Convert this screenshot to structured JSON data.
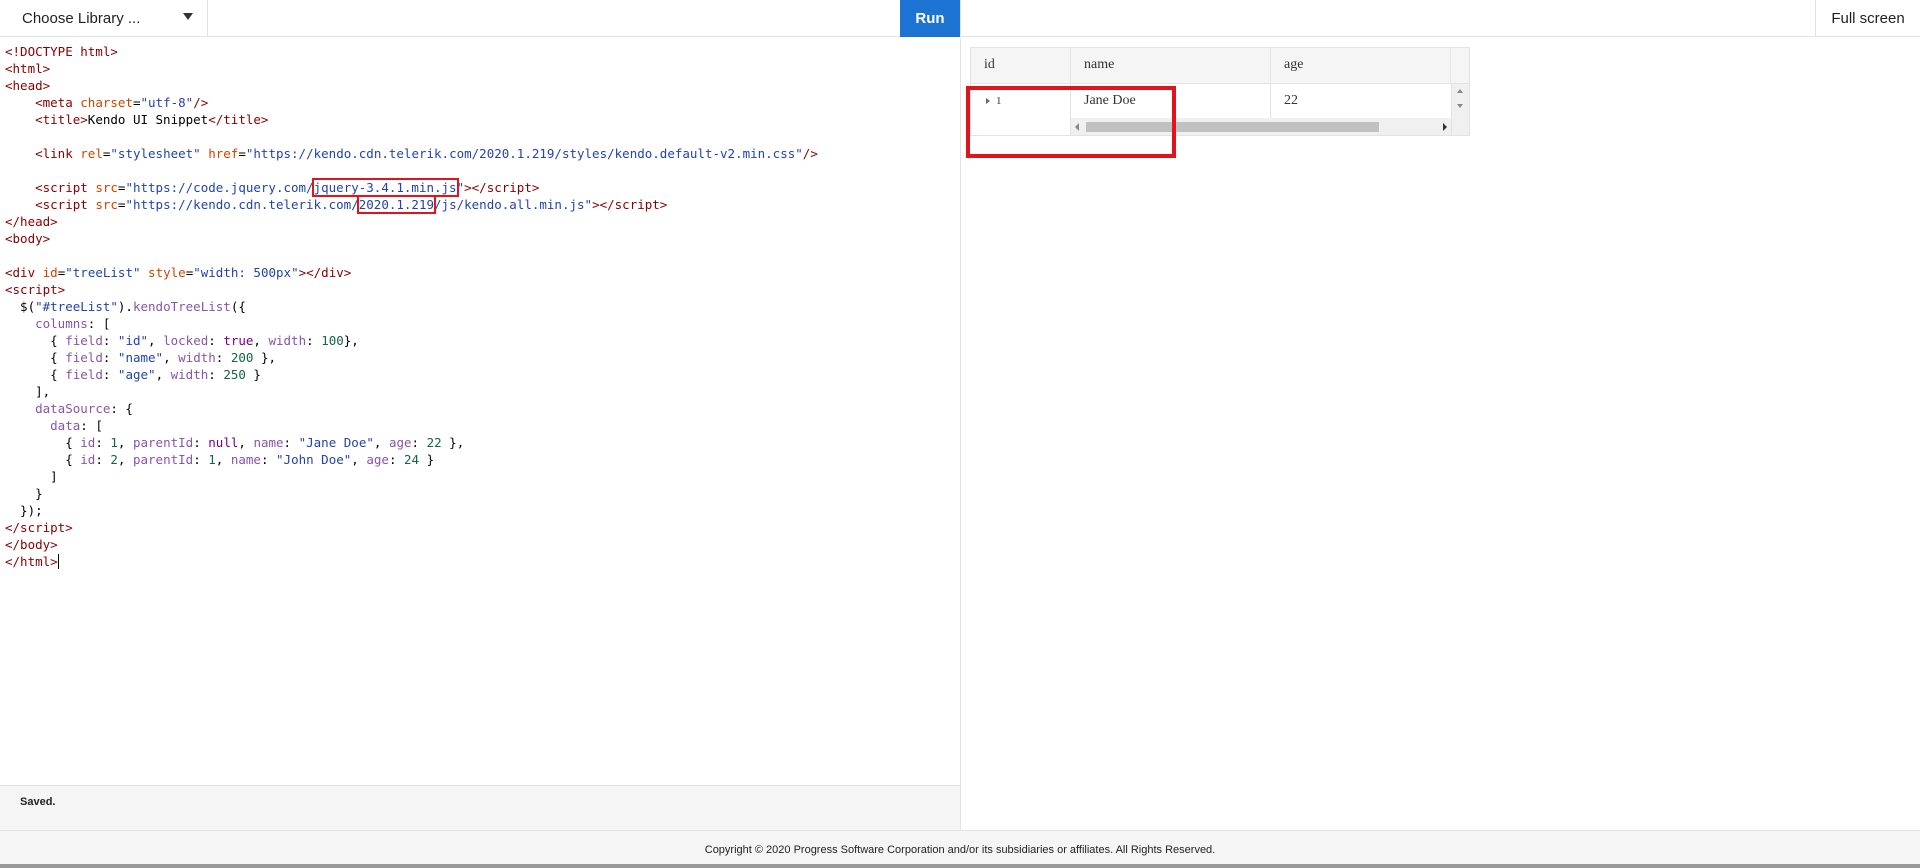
{
  "toolbar": {
    "library_label": "Choose Library ...",
    "run_label": "Run",
    "fullscreen_label": "Full screen"
  },
  "editor": {
    "lines": {
      "l1": "<!DOCTYPE html>",
      "l2": "<html>",
      "l3": "<head>",
      "meta_charset": "utf-8",
      "title_text": "Kendo UI Snippet",
      "link_href": "https://kendo.cdn.telerik.com/2020.1.219/styles/kendo.default-v2.min.css",
      "script1_prefix": "https://code.jquery.com/",
      "script1_file": "jquery-3.4.1.min.js",
      "script2_prefix": "https://kendo.cdn.telerik.com/",
      "script2_version": "2020.1.219",
      "script2_suffix": "/js/kendo.all.min.js",
      "div_id": "treeList",
      "div_style": "width: 500px",
      "selector": "\"#treeList\"",
      "method": "kendoTreeList",
      "field_id": "\"id\"",
      "field_name": "\"name\"",
      "field_age": "\"age\"",
      "name1": "\"Jane Doe\"",
      "name2": "\"John Doe\""
    }
  },
  "status": {
    "text": "Saved."
  },
  "preview": {
    "columns": [
      "id",
      "name",
      "age"
    ],
    "row": {
      "id": "1",
      "name": "Jane Doe",
      "age": "22"
    }
  },
  "footer": {
    "copyright": "Copyright © 2020 Progress Software Corporation and/or its subsidiaries or affiliates. All Rights Reserved."
  },
  "colors": {
    "run_button": "#1d73d1",
    "highlight": "#e0141b"
  }
}
